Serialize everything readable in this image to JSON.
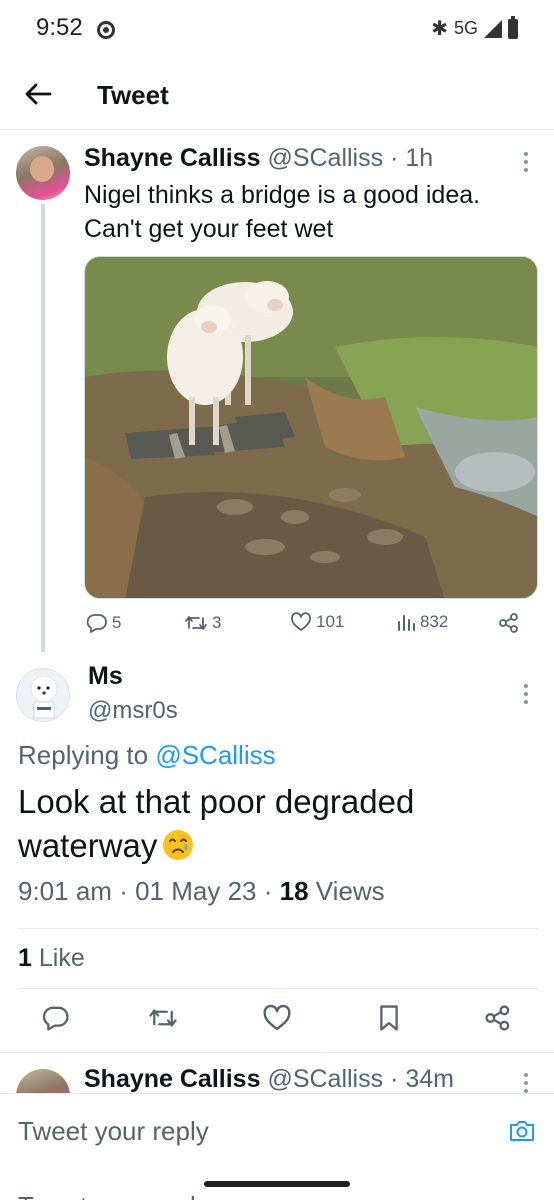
{
  "status_bar": {
    "time": "9:52",
    "network": "5G"
  },
  "header": {
    "title": "Tweet"
  },
  "thread_tweet": {
    "display_name": "Shayne Calliss",
    "handle": "@SCalliss",
    "separator": "·",
    "time": "1h",
    "text_line1": "Nigel thinks a bridge is a good idea.",
    "text_line2": "Can't get your feet wet",
    "replies": "5",
    "retweets": "3",
    "likes": "101",
    "views": "832"
  },
  "main_tweet": {
    "display_name": "Ms",
    "handle": "@msr0s",
    "replying_prefix": "Replying to",
    "replying_to": "@SCalliss",
    "text_line1": "Look at that poor degraded",
    "text_line2": "waterway",
    "time": "9:01 am",
    "date": "01 May 23",
    "separator": "·",
    "view_count": "18",
    "view_label": "Views",
    "like_count": "1",
    "like_label": "Like"
  },
  "next_reply": {
    "display_name": "Shayne Calliss",
    "handle": "@SCalliss",
    "separator": "·",
    "time": "34m"
  },
  "composer": {
    "placeholder": "Tweet your reply",
    "ghost_text": "Tweet your reply"
  },
  "colors": {
    "accent": "#1d9bf0",
    "text": "#0f1419",
    "muted": "#536471",
    "divider": "#e5e9ec"
  }
}
